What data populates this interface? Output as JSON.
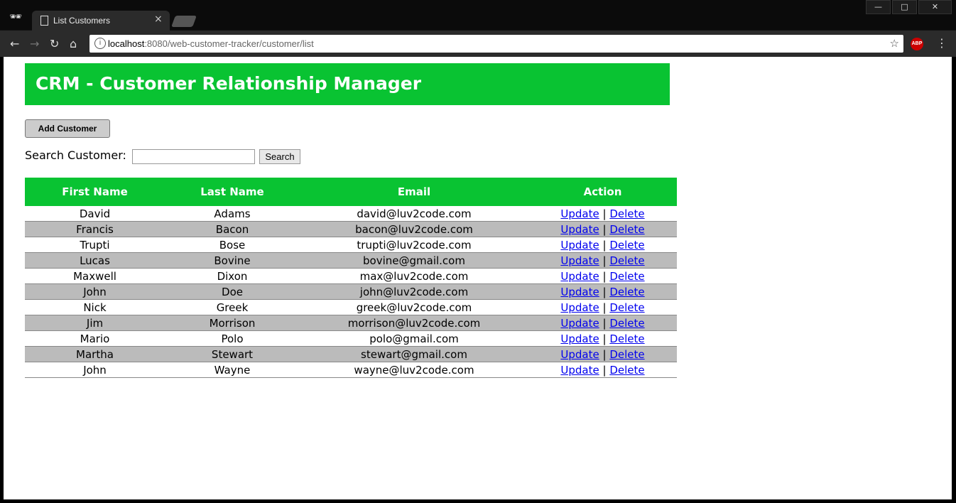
{
  "browser": {
    "tab_title": "List Customers",
    "tab_close": "×",
    "url_host": "localhost",
    "url_rest": ":8080/web-customer-tracker/customer/list",
    "info_icon": "i",
    "abp_label": "ABP"
  },
  "page": {
    "header_title": "CRM - Customer Relationship Manager",
    "add_button": "Add Customer",
    "search_label": "Search Customer:",
    "search_value": "",
    "search_button": "Search"
  },
  "table": {
    "headers": [
      "First Name",
      "Last Name",
      "Email",
      "Action"
    ],
    "update_label": "Update",
    "delete_label": "Delete",
    "separator": "|",
    "rows": [
      {
        "first": "David",
        "last": "Adams",
        "email": "david@luv2code.com"
      },
      {
        "first": "Francis",
        "last": "Bacon",
        "email": "bacon@luv2code.com"
      },
      {
        "first": "Trupti",
        "last": "Bose",
        "email": "trupti@luv2code.com"
      },
      {
        "first": "Lucas",
        "last": "Bovine",
        "email": "bovine@gmail.com"
      },
      {
        "first": "Maxwell",
        "last": "Dixon",
        "email": "max@luv2code.com"
      },
      {
        "first": "John",
        "last": "Doe",
        "email": "john@luv2code.com"
      },
      {
        "first": "Nick",
        "last": "Greek",
        "email": "greek@luv2code.com"
      },
      {
        "first": "Jim",
        "last": "Morrison",
        "email": "morrison@luv2code.com"
      },
      {
        "first": "Mario",
        "last": "Polo",
        "email": "polo@gmail.com"
      },
      {
        "first": "Martha",
        "last": "Stewart",
        "email": "stewart@gmail.com"
      },
      {
        "first": "John",
        "last": "Wayne",
        "email": "wayne@luv2code.com"
      }
    ]
  },
  "colors": {
    "header_green": "#09c332",
    "stripe_gray": "#bbbbbb",
    "link_blue": "#0000ee"
  }
}
